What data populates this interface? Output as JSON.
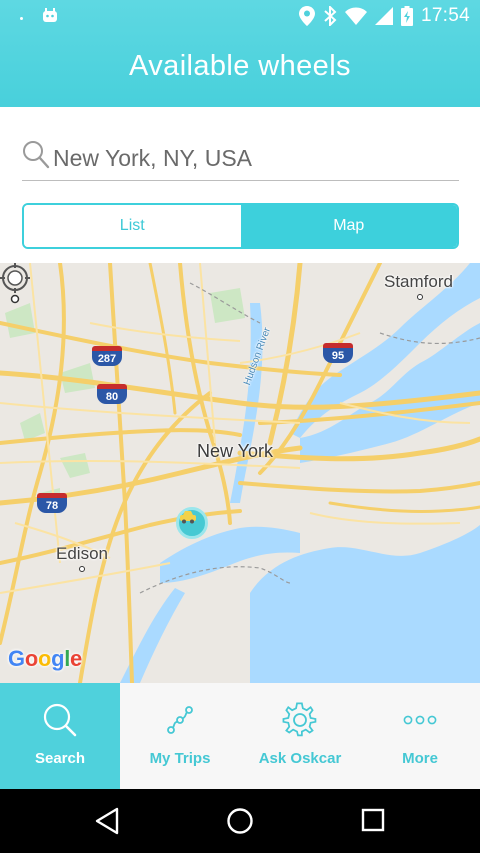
{
  "status_bar": {
    "time": "17:54"
  },
  "header": {
    "title": "Available wheels"
  },
  "search": {
    "value": "New York, NY, USA"
  },
  "segmented": {
    "list_label": "List",
    "map_label": "Map",
    "selected": "Map"
  },
  "map": {
    "labels": {
      "stamford": "Stamford",
      "new_york": "New York",
      "edison": "Edison",
      "hudson_river": "Hudson River"
    },
    "shields": {
      "i287": "287",
      "i80": "80",
      "i95": "95",
      "i78": "78"
    },
    "attribution": [
      "G",
      "o",
      "o",
      "g",
      "l",
      "e"
    ]
  },
  "bottom_nav": {
    "items": [
      {
        "label": "Search",
        "icon": "search-icon",
        "active": true
      },
      {
        "label": "My Trips",
        "icon": "trips-icon",
        "active": false
      },
      {
        "label": "Ask Oskcar",
        "icon": "gear-icon",
        "active": false
      },
      {
        "label": "More",
        "icon": "more-dots-icon",
        "active": false
      }
    ]
  },
  "colors": {
    "accent": "#48d0db",
    "nav_label": "#45c8d4",
    "water": "#aadaff",
    "roads": "#f5cf6a"
  }
}
